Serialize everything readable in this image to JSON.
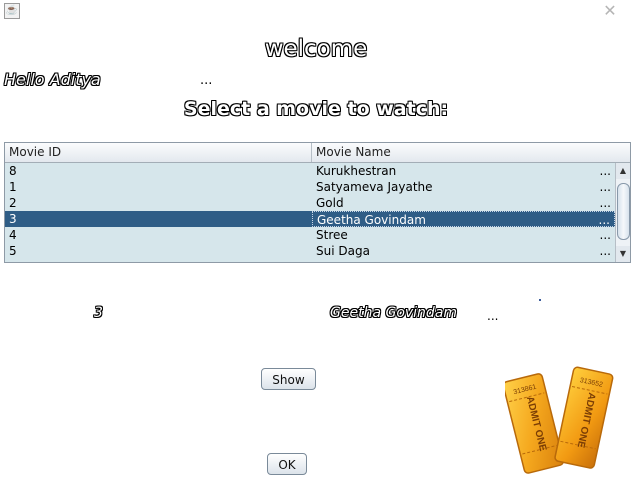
{
  "window": {
    "app_icon_glyph": "☕",
    "close_glyph": "✕"
  },
  "header": {
    "title": "welcome",
    "greeting": "Hello Aditya",
    "greeting_suffix": "...",
    "prompt": "Select a movie to watch:"
  },
  "table": {
    "columns": [
      "Movie ID",
      "Movie Name"
    ],
    "rows": [
      {
        "id": "8",
        "name": "Kurukhestran",
        "ellipsis": "..."
      },
      {
        "id": "1",
        "name": "Satyameva Jayathe",
        "ellipsis": "..."
      },
      {
        "id": "2",
        "name": "Gold",
        "ellipsis": "..."
      },
      {
        "id": "3",
        "name": "Geetha Govindam",
        "ellipsis": "..."
      },
      {
        "id": "4",
        "name": "Stree",
        "ellipsis": "..."
      },
      {
        "id": "5",
        "name": "Sui Daga",
        "ellipsis": "..."
      }
    ],
    "selected_index": 3,
    "scroll_arrows": {
      "up": "▲",
      "down": "▼"
    }
  },
  "selection": {
    "id": "3",
    "name": "Geetha Govindam",
    "suffix": "..."
  },
  "buttons": {
    "show": "Show",
    "ok": "OK"
  },
  "tickets": {
    "label": "ADMIT ONE",
    "numbers": [
      "313861",
      "313652"
    ]
  },
  "colors": {
    "selected_row": "#2f5d86",
    "table_bg": "#d6e6eb",
    "ticket_orange": "#f2a81d"
  }
}
